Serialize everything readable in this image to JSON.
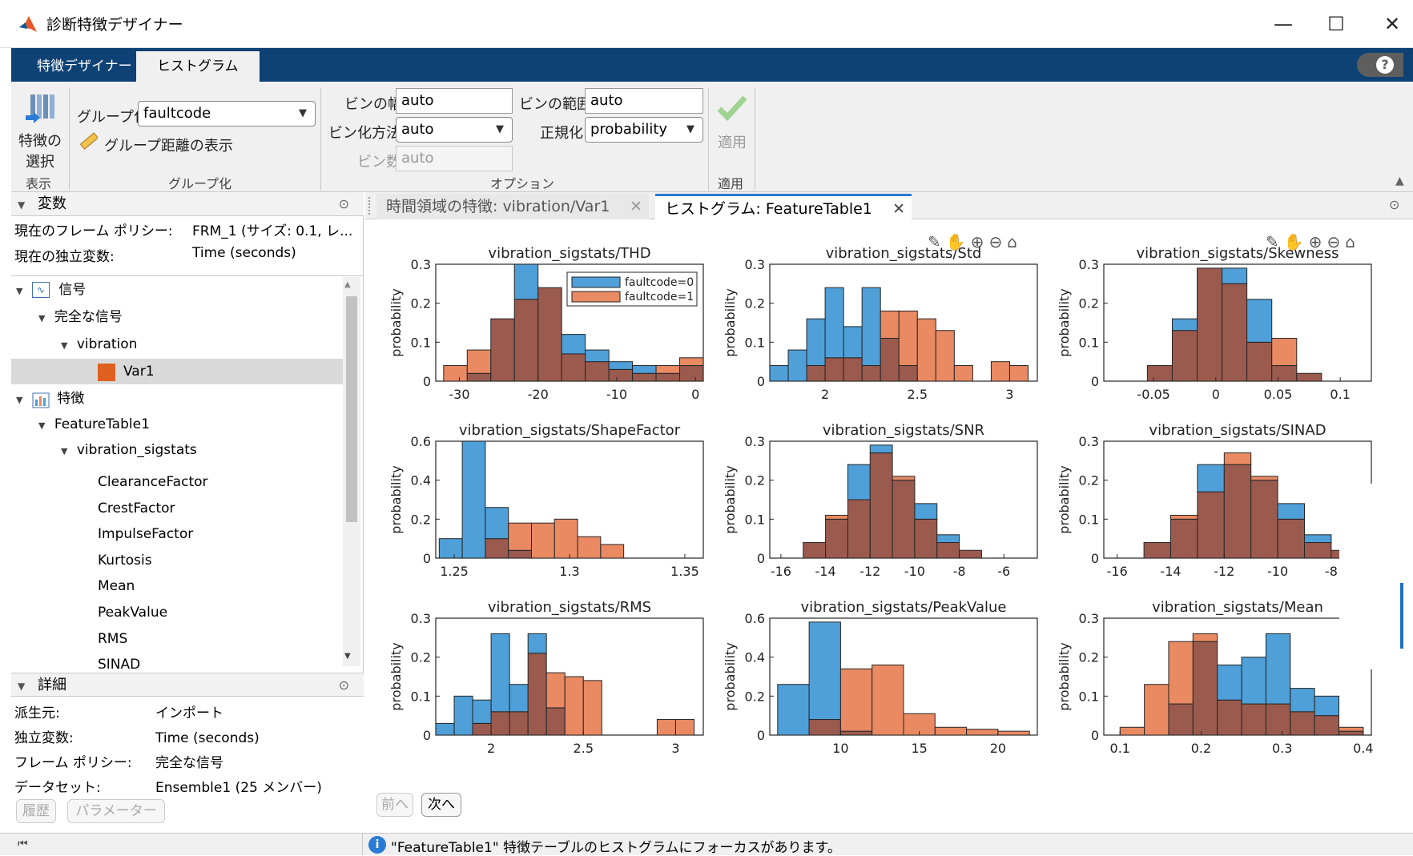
{
  "window": {
    "title": "診断特徴デザイナー",
    "minimize": "—",
    "maximize": "☐",
    "close": "✕",
    "help": "?"
  },
  "tabs": [
    {
      "label": "特徴デザイナー"
    },
    {
      "label": "ヒストグラム"
    }
  ],
  "ribbon": {
    "display_group": {
      "select_features_line1": "特徴の",
      "select_features_line2": "選択",
      "label": "表示"
    },
    "grouping_group": {
      "group_by_label": "グループ化",
      "group_by_value": "faultcode",
      "show_distance": "グループ距離の表示",
      "label": "グループ化"
    },
    "options_group": {
      "bin_width_label": "ビンの幅",
      "bin_width_value": "auto",
      "bin_range_label": "ビンの範囲",
      "bin_range_value": "auto",
      "bin_method_label": "ビン化方法",
      "bin_method_value": "auto",
      "normalization_label": "正規化",
      "normalization_value": "probability",
      "num_bins_label": "ビン数",
      "num_bins_value": "auto",
      "label": "オプション"
    },
    "apply_group": {
      "apply_button": "適用",
      "label": "適用"
    }
  },
  "variables_panel": {
    "title": "変数",
    "frame_policy_label": "現在のフレーム ポリシー:",
    "frame_policy_value": "FRM_1 (サイズ: 0.1, レ...",
    "indep_var_label": "現在の独立変数:",
    "indep_var_value": "Time (seconds)",
    "tree": {
      "signals": "信号",
      "full_signal": "完全な信号",
      "vibration": "vibration",
      "var1": "Var1",
      "features": "特徴",
      "feature_table": "FeatureTable1",
      "sigstats": "vibration_sigstats",
      "features_list": [
        "ClearanceFactor",
        "CrestFactor",
        "ImpulseFactor",
        "Kurtosis",
        "Mean",
        "PeakValue",
        "RMS",
        "SINAD"
      ]
    }
  },
  "details_panel": {
    "title": "詳細",
    "rows": [
      {
        "label": "派生元:",
        "value": "インポート"
      },
      {
        "label": "独立変数:",
        "value": "Time (seconds)"
      },
      {
        "label": "フレーム ポリシー:",
        "value": "完全な信号"
      },
      {
        "label": "データセット:",
        "value": "Ensemble1 (25 メンバー)"
      }
    ],
    "history_button": "履歴",
    "params_button": "パラメーター"
  },
  "doc_tabs": [
    {
      "label": "時間領域の特徴: vibration/Var1"
    },
    {
      "label": "ヒストグラム: FeatureTable1"
    }
  ],
  "nav": {
    "prev": "前へ",
    "next": "次へ"
  },
  "status": {
    "message": "\"FeatureTable1\" 特徴テーブルのヒストグラムにフォーカスがあります。"
  },
  "colors": {
    "faultcode0": "#4f9fd8",
    "faultcode1": "#e98a63",
    "overlap": "#9b5a4e",
    "ribbon_tab_bg": "#0e4275"
  },
  "chart_data": [
    {
      "type": "bar",
      "title": "vibration_sigstats/THD",
      "ylabel": "probability",
      "xlim": [
        -33,
        1
      ],
      "ylim": [
        0,
        0.3
      ],
      "xticks": [
        "-30",
        "-20",
        "-10",
        "0"
      ],
      "xtick_values": [
        -30,
        -20,
        -10,
        0
      ],
      "yticks": [
        "0",
        "0.1",
        "0.2",
        "0.3"
      ],
      "legend": [
        "faultcode=0",
        "faultcode=1"
      ],
      "legend_position": "top-right",
      "bin_edges": [
        -32,
        -29,
        -26,
        -23,
        -20,
        -17,
        -14,
        -11,
        -8,
        -5,
        -2,
        1
      ],
      "series": [
        {
          "name": "faultcode=0",
          "values": [
            0.0,
            0.02,
            0.16,
            0.3,
            0.24,
            0.12,
            0.08,
            0.05,
            0.04,
            0.02,
            0.04
          ]
        },
        {
          "name": "faultcode=1",
          "values": [
            0.04,
            0.08,
            0.16,
            0.21,
            0.24,
            0.07,
            0.05,
            0.03,
            0.02,
            0.04,
            0.06
          ]
        }
      ]
    },
    {
      "type": "bar",
      "title": "vibration_sigstats/Std",
      "ylabel": "probability",
      "xlim": [
        1.7,
        3.15
      ],
      "ylim": [
        0,
        0.3
      ],
      "xticks": [
        "2",
        "2.5",
        "3"
      ],
      "xtick_values": [
        2,
        2.5,
        3
      ],
      "yticks": [
        "0",
        "0.1",
        "0.2",
        "0.3"
      ],
      "bin_edges": [
        1.7,
        1.8,
        1.9,
        2.0,
        2.1,
        2.2,
        2.3,
        2.4,
        2.5,
        2.6,
        2.7,
        2.8,
        2.9,
        3.0,
        3.1
      ],
      "series": [
        {
          "name": "faultcode=0",
          "values": [
            0.04,
            0.08,
            0.16,
            0.24,
            0.14,
            0.24,
            0.11,
            0.04,
            0.0,
            0.0,
            0.0,
            0.0,
            0.0,
            0.0
          ]
        },
        {
          "name": "faultcode=1",
          "values": [
            0.0,
            0.0,
            0.04,
            0.06,
            0.06,
            0.04,
            0.18,
            0.18,
            0.16,
            0.13,
            0.04,
            0.0,
            0.05,
            0.04
          ]
        }
      ]
    },
    {
      "type": "bar",
      "title": "vibration_sigstats/Skewness",
      "ylabel": "probability",
      "xlim": [
        -0.09,
        0.125
      ],
      "ylim": [
        0,
        0.3
      ],
      "xticks": [
        "-0.05",
        "0",
        "0.05",
        "0.1"
      ],
      "xtick_values": [
        -0.05,
        0,
        0.05,
        0.1
      ],
      "yticks": [
        "0",
        "0.1",
        "0.2",
        "0.3"
      ],
      "bin_edges": [
        -0.075,
        -0.055,
        -0.035,
        -0.015,
        0.005,
        0.025,
        0.045,
        0.065,
        0.085,
        0.105
      ],
      "series": [
        {
          "name": "faultcode=0",
          "values": [
            0.0,
            0.04,
            0.16,
            0.29,
            0.29,
            0.21,
            0.04,
            0.02,
            0.0
          ]
        },
        {
          "name": "faultcode=1",
          "values": [
            0.0,
            0.04,
            0.13,
            0.29,
            0.25,
            0.1,
            0.11,
            0.02,
            0.0
          ]
        }
      ]
    },
    {
      "type": "bar",
      "title": "vibration_sigstats/ShapeFactor",
      "ylabel": "probability",
      "xlim": [
        1.242,
        1.358
      ],
      "ylim": [
        0,
        0.6
      ],
      "xticks": [
        "1.25",
        "1.3",
        "1.35"
      ],
      "xtick_values": [
        1.25,
        1.3,
        1.35
      ],
      "yticks": [
        "0",
        "0.2",
        "0.4",
        "0.6"
      ],
      "bin_edges": [
        1.2435,
        1.2535,
        1.2635,
        1.2735,
        1.2835,
        1.2935,
        1.3035,
        1.3135,
        1.3235,
        1.3335,
        1.3435,
        1.3535
      ],
      "series": [
        {
          "name": "faultcode=0",
          "values": [
            0.1,
            0.6,
            0.26,
            0.04,
            0.0,
            0.0,
            0.0,
            0.0,
            0.0,
            0.0,
            0.0
          ]
        },
        {
          "name": "faultcode=1",
          "values": [
            0.0,
            0.0,
            0.1,
            0.18,
            0.18,
            0.2,
            0.11,
            0.07,
            0.0,
            0.0,
            0.0
          ]
        }
      ]
    },
    {
      "type": "bar",
      "title": "vibration_sigstats/SNR",
      "ylabel": "probability",
      "xlim": [
        -16.5,
        -4.5
      ],
      "ylim": [
        0,
        0.3
      ],
      "xticks": [
        "-16",
        "-14",
        "-12",
        "-10",
        "-8",
        "-6"
      ],
      "xtick_values": [
        -16,
        -14,
        -12,
        -10,
        -8,
        -6
      ],
      "yticks": [
        "0",
        "0.1",
        "0.2",
        "0.3"
      ],
      "bin_edges": [
        -16,
        -15,
        -14,
        -13,
        -12,
        -11,
        -10,
        -9,
        -8,
        -7,
        -6,
        -5
      ],
      "series": [
        {
          "name": "faultcode=0",
          "values": [
            0.0,
            0.04,
            0.1,
            0.24,
            0.29,
            0.2,
            0.14,
            0.06,
            0.02,
            0.0,
            0.0
          ]
        },
        {
          "name": "faultcode=1",
          "values": [
            0.0,
            0.04,
            0.11,
            0.15,
            0.27,
            0.21,
            0.1,
            0.04,
            0.02,
            0.0,
            0.0
          ]
        }
      ]
    },
    {
      "type": "bar",
      "title": "vibration_sigstats/SINAD",
      "ylabel": "probability",
      "xlim": [
        -16.5,
        -6.5
      ],
      "ylim": [
        0,
        0.3
      ],
      "xticks": [
        "-16",
        "-14",
        "-12",
        "-10",
        "-8"
      ],
      "xtick_values": [
        -16,
        -14,
        -12,
        -10,
        -8
      ],
      "yticks": [
        "0",
        "0.1",
        "0.2",
        "0.3"
      ],
      "bin_edges": [
        -16,
        -15,
        -14,
        -13,
        -12,
        -11,
        -10,
        -9,
        -8,
        -7
      ],
      "series": [
        {
          "name": "faultcode=0",
          "values": [
            0.0,
            0.04,
            0.1,
            0.24,
            0.24,
            0.2,
            0.14,
            0.06,
            0.02
          ]
        },
        {
          "name": "faultcode=1",
          "values": [
            0.0,
            0.04,
            0.11,
            0.17,
            0.27,
            0.21,
            0.1,
            0.04,
            0.02
          ]
        }
      ]
    },
    {
      "type": "bar",
      "title": "vibration_sigstats/RMS",
      "ylabel": "probability",
      "xlim": [
        1.7,
        3.15
      ],
      "ylim": [
        0,
        0.3
      ],
      "xticks": [
        "2",
        "2.5",
        "3"
      ],
      "xtick_values": [
        2,
        2.5,
        3
      ],
      "yticks": [
        "0",
        "0.1",
        "0.2",
        "0.3"
      ],
      "bin_edges": [
        1.7,
        1.8,
        1.9,
        2.0,
        2.1,
        2.2,
        2.3,
        2.4,
        2.5,
        2.6,
        2.7,
        2.8,
        2.9,
        3.0,
        3.1
      ],
      "series": [
        {
          "name": "faultcode=0",
          "values": [
            0.03,
            0.1,
            0.09,
            0.26,
            0.13,
            0.26,
            0.07,
            0.0,
            0.0,
            0.0,
            0.0,
            0.0,
            0.0,
            0.0
          ]
        },
        {
          "name": "faultcode=1",
          "values": [
            0.0,
            0.0,
            0.03,
            0.06,
            0.06,
            0.21,
            0.16,
            0.15,
            0.14,
            0.0,
            0.0,
            0.0,
            0.04,
            0.04
          ]
        }
      ]
    },
    {
      "type": "bar",
      "title": "vibration_sigstats/PeakValue",
      "ylabel": "probability",
      "xlim": [
        5.5,
        22.5
      ],
      "ylim": [
        0,
        0.6
      ],
      "xticks": [
        "10",
        "15",
        "20"
      ],
      "xtick_values": [
        10,
        15,
        20
      ],
      "yticks": [
        "0",
        "0.2",
        "0.4",
        "0.6"
      ],
      "bin_edges": [
        6,
        8,
        10,
        12,
        14,
        16,
        18,
        20,
        22
      ],
      "series": [
        {
          "name": "faultcode=0",
          "values": [
            0.26,
            0.58,
            0.02,
            0.0,
            0.0,
            0.0,
            0.0,
            0.0
          ]
        },
        {
          "name": "faultcode=1",
          "values": [
            0.0,
            0.08,
            0.34,
            0.36,
            0.11,
            0.04,
            0.03,
            0.02
          ]
        }
      ]
    },
    {
      "type": "bar",
      "title": "vibration_sigstats/Mean",
      "ylabel": "probability",
      "xlim": [
        0.08,
        0.41
      ],
      "ylim": [
        0,
        0.3
      ],
      "xticks": [
        "0.1",
        "0.2",
        "0.3",
        "0.4"
      ],
      "xtick_values": [
        0.1,
        0.2,
        0.3,
        0.4
      ],
      "yticks": [
        "0",
        "0.1",
        "0.2",
        "0.3"
      ],
      "bin_edges": [
        0.1,
        0.13,
        0.16,
        0.19,
        0.22,
        0.25,
        0.28,
        0.31,
        0.34,
        0.37,
        0.4
      ],
      "series": [
        {
          "name": "faultcode=0",
          "values": [
            0.0,
            0.0,
            0.08,
            0.24,
            0.18,
            0.2,
            0.26,
            0.12,
            0.1,
            0.01
          ]
        },
        {
          "name": "faultcode=1",
          "values": [
            0.02,
            0.13,
            0.24,
            0.26,
            0.09,
            0.08,
            0.08,
            0.06,
            0.05,
            0.02
          ]
        }
      ]
    }
  ]
}
